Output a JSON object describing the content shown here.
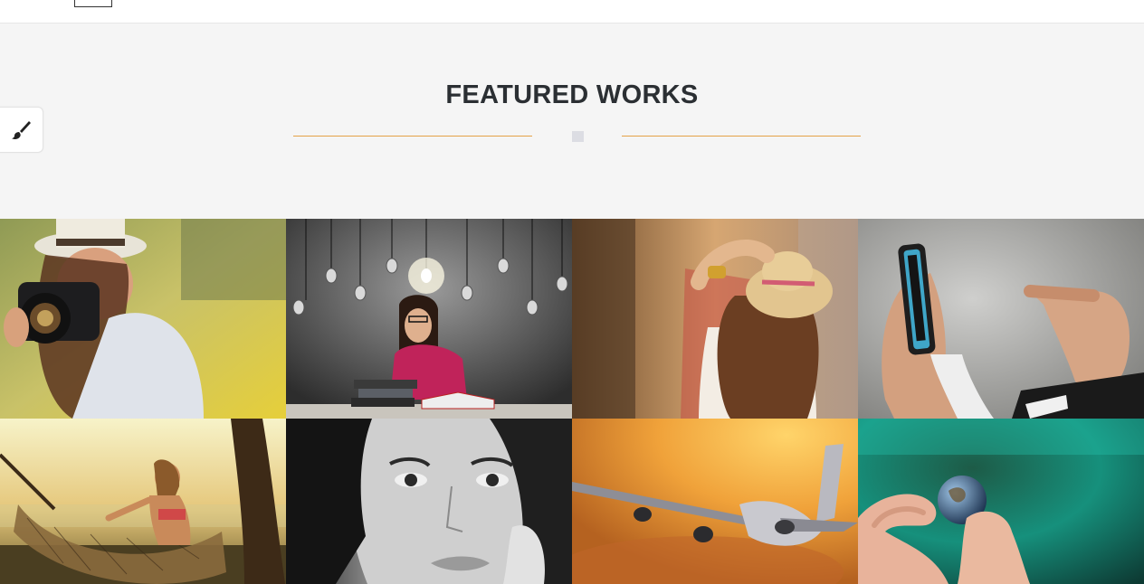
{
  "header": {
    "menu_icon": "menu-toggle-icon"
  },
  "style_switcher": {
    "icon": "paintbrush-icon"
  },
  "section": {
    "title": "FEATURED WORKS",
    "accent_color": "#e4a247",
    "divider_square_color": "#dcdde3"
  },
  "gallery": {
    "items": [
      {
        "subject": "woman-with-camera-photo"
      },
      {
        "subject": "girl-with-lightbulbs-photo"
      },
      {
        "subject": "woman-with-straw-hat-photo"
      },
      {
        "subject": "hand-holding-phone-photo"
      },
      {
        "subject": "woman-in-hammock-photo"
      },
      {
        "subject": "woman-face-bw-photo"
      },
      {
        "subject": "airplane-sunset-photo"
      },
      {
        "subject": "hand-holding-globe-photo"
      }
    ]
  }
}
